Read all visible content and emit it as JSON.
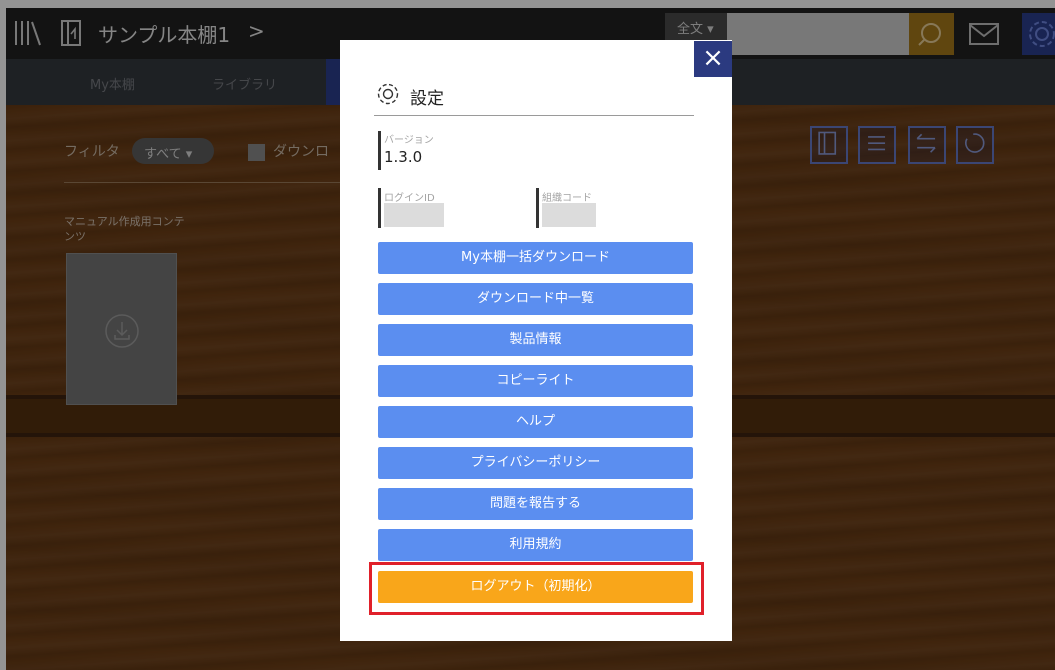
{
  "header": {
    "title": "サンプル本棚1",
    "chevron": ">",
    "search_scope": "全文 ▾"
  },
  "nav": {
    "tabs": [
      "My本棚",
      "ライブラリ"
    ]
  },
  "filter": {
    "label": "フィルタ",
    "selected": "すべて ▾",
    "download_label": "ダウンロ"
  },
  "book": {
    "title": "マニュアル作成用コンテンツ"
  },
  "modal": {
    "title": "設定",
    "close": "×",
    "version_label": "バージョン",
    "version_value": "1.3.0",
    "login_id_label": "ログインID",
    "org_code_label": "組織コード",
    "buttons": [
      "My本棚一括ダウンロード",
      "ダウンロード中一覧",
      "製品情報",
      "コピーライト",
      "ヘルプ",
      "プライバシーポリシー",
      "問題を報告する",
      "利用規約"
    ],
    "logout": "ログアウト（初期化）"
  },
  "colors": {
    "accent_blue": "#5b8ef0",
    "logout_orange": "#f9a61a",
    "highlight_red": "#e0202a",
    "wood": "#6e3f17"
  }
}
